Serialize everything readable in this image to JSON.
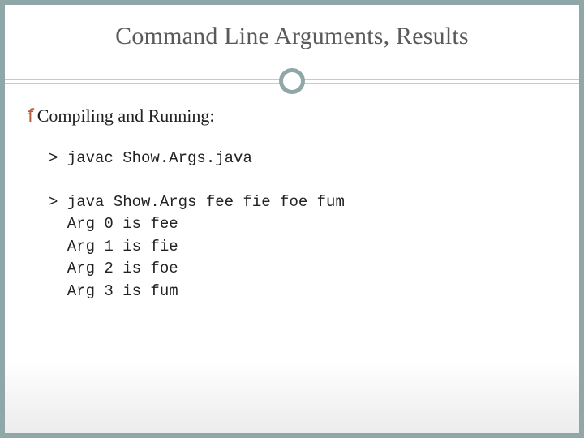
{
  "title": "Command Line Arguments, Results",
  "bullet": "Compiling and Running:",
  "code": {
    "compile": "> javac Show.Args.java",
    "run": "> java Show.Args fee fie foe fum",
    "out0": "  Arg 0 is fee",
    "out1": "  Arg 1 is fie",
    "out2": "  Arg 2 is foe",
    "out3": "  Arg 3 is fum"
  }
}
